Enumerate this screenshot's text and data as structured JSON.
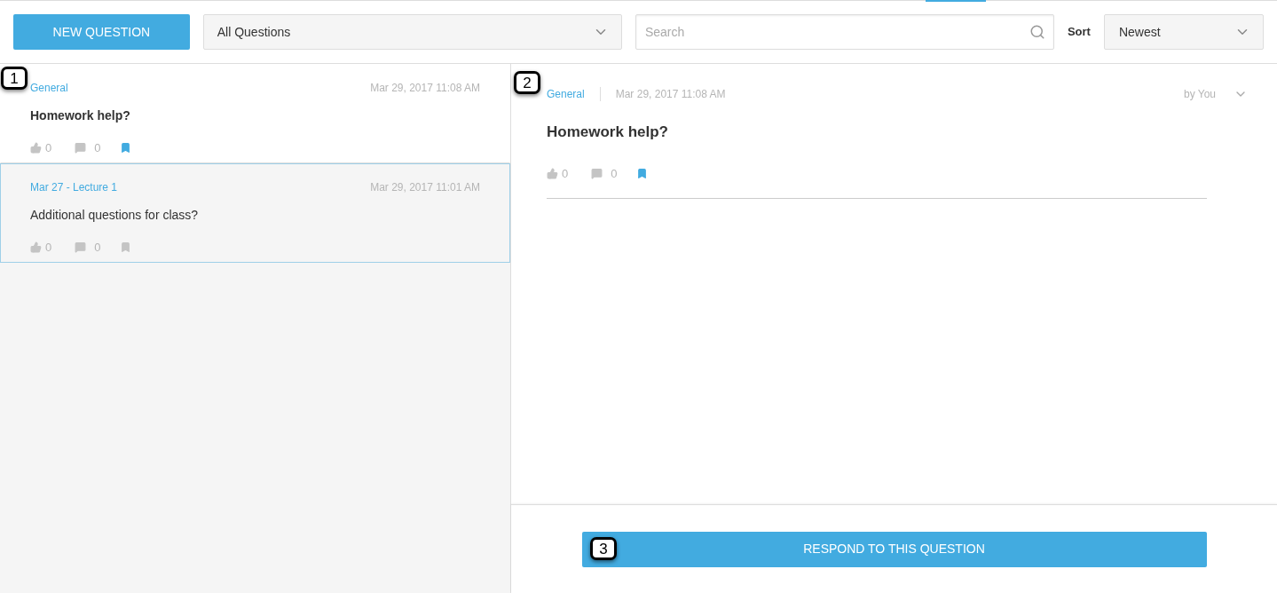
{
  "toolbar": {
    "new_button": "NEW QUESTION",
    "filter": {
      "value": "All Questions"
    },
    "search": {
      "placeholder": "Search"
    },
    "sort_label": "Sort",
    "sort": {
      "value": "Newest"
    }
  },
  "questions": [
    {
      "category": "General",
      "date": "Mar 29, 2017 11:08 AM",
      "title": "Homework help?",
      "likes": "0",
      "comments": "0",
      "bookmarked": true,
      "unread": true,
      "selected": false,
      "callout": "1"
    },
    {
      "category": "Mar 27 - Lecture 1",
      "date": "Mar 29, 2017 11:01 AM",
      "title": "Additional questions for class?",
      "likes": "0",
      "comments": "0",
      "bookmarked": false,
      "unread": false,
      "selected": true
    }
  ],
  "detail": {
    "callout": "2",
    "category": "General",
    "date": "Mar 29, 2017 11:08 AM",
    "author": "by You",
    "title": "Homework help?",
    "likes": "0",
    "comments": "0",
    "bookmarked": true
  },
  "respond": {
    "label": "RESPOND TO THIS QUESTION",
    "callout": "3"
  }
}
